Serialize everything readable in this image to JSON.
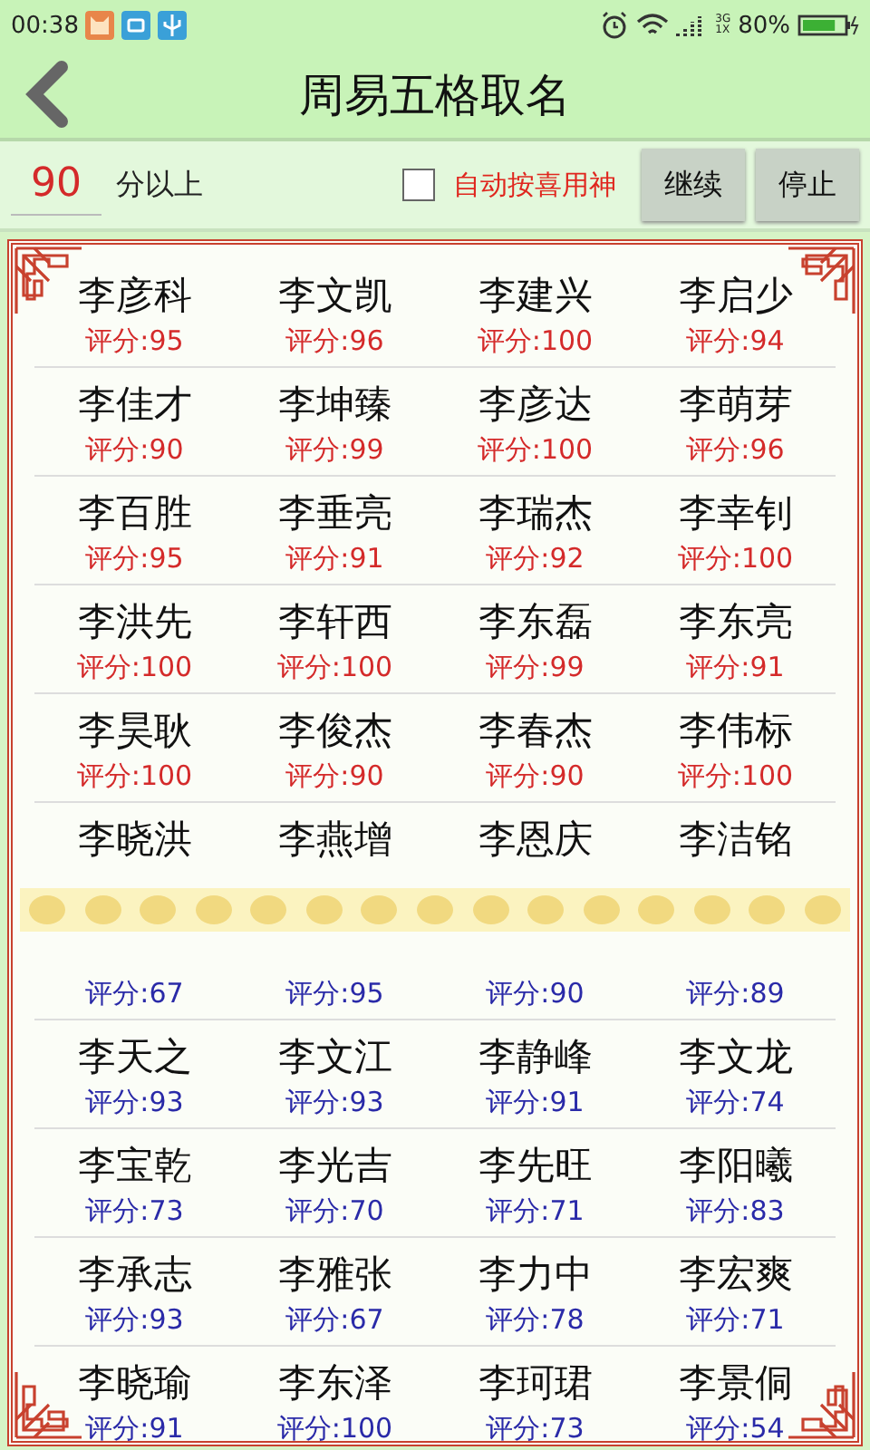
{
  "status_bar": {
    "time": "00:38",
    "network_top": "3G",
    "network_bottom": "1X",
    "battery": "80%"
  },
  "title_bar": {
    "title": "周易五格取名"
  },
  "controls": {
    "score_field": {
      "value": "90"
    },
    "score_suffix": "分以上",
    "auto_checkbox": {
      "label": "自动按喜用神",
      "checked": false
    },
    "buttons": [
      "继续",
      "停止"
    ]
  },
  "rows": [
    {
      "color": "#d42a2a",
      "cells": [
        {
          "name": "李彦科",
          "score": "评分:95"
        },
        {
          "name": "李文凯",
          "score": "评分:96"
        },
        {
          "name": "李建兴",
          "score": "评分:100"
        },
        {
          "name": "李启少",
          "score": "评分:94"
        }
      ]
    },
    {
      "color": "#d42a2a",
      "cells": [
        {
          "name": "李佳才",
          "score": "评分:90"
        },
        {
          "name": "李坤臻",
          "score": "评分:99"
        },
        {
          "name": "李彦达",
          "score": "评分:100"
        },
        {
          "name": "李萌芽",
          "score": "评分:96"
        }
      ]
    },
    {
      "color": "#d42a2a",
      "cells": [
        {
          "name": "李百胜",
          "score": "评分:95"
        },
        {
          "name": "李垂亮",
          "score": "评分:91"
        },
        {
          "name": "李瑞杰",
          "score": "评分:92"
        },
        {
          "name": "李幸钊",
          "score": "评分:100"
        }
      ]
    },
    {
      "color": "#d42a2a",
      "cells": [
        {
          "name": "李洪先",
          "score": "评分:100"
        },
        {
          "name": "李轩西",
          "score": "评分:100"
        },
        {
          "name": "李东磊",
          "score": "评分:99"
        },
        {
          "name": "李东亮",
          "score": "评分:91"
        }
      ]
    },
    {
      "color": "#d42a2a",
      "cells": [
        {
          "name": "李昊耿",
          "score": "评分:100"
        },
        {
          "name": "李俊杰",
          "score": "评分:90"
        },
        {
          "name": "李春杰",
          "score": "评分:90"
        },
        {
          "name": "李伟标",
          "score": "评分:100"
        }
      ]
    },
    {
      "cells": [
        {
          "name": "李晓洪"
        },
        {
          "name": "李燕增"
        },
        {
          "name": "李恩庆"
        },
        {
          "name": "李洁铭"
        }
      ]
    },
    {
      "color": "#2a2aa8",
      "cells": [
        {
          "score": "评分:67"
        },
        {
          "score": "评分:95"
        },
        {
          "score": "评分:90"
        },
        {
          "score": "评分:89"
        }
      ]
    },
    {
      "color": "#2a2aa8",
      "cells": [
        {
          "name": "李天之",
          "score": "评分:93"
        },
        {
          "name": "李文江",
          "score": "评分:93"
        },
        {
          "name": "李静峰",
          "score": "评分:91"
        },
        {
          "name": "李文龙",
          "score": "评分:74"
        }
      ]
    },
    {
      "color": "#2a2aa8",
      "cells": [
        {
          "name": "李宝乾",
          "score": "评分:73"
        },
        {
          "name": "李光吉",
          "score": "评分:70"
        },
        {
          "name": "李先旺",
          "score": "评分:71"
        },
        {
          "name": "李阳曦",
          "score": "评分:83"
        }
      ]
    },
    {
      "color": "#2a2aa8",
      "cells": [
        {
          "name": "李承志",
          "score": "评分:93"
        },
        {
          "name": "李雅张",
          "score": "评分:67"
        },
        {
          "name": "李力中",
          "score": "评分:78"
        },
        {
          "name": "李宏爽",
          "score": "评分:71"
        }
      ]
    },
    {
      "color": "#2a2aa8",
      "cells": [
        {
          "name": "李晓瑜",
          "score": "评分:91"
        },
        {
          "name": "李东泽",
          "score": "评分:100"
        },
        {
          "name": "李珂珺",
          "score": "评分:73"
        },
        {
          "name": "李景侗",
          "score": "评分:54"
        }
      ]
    }
  ]
}
